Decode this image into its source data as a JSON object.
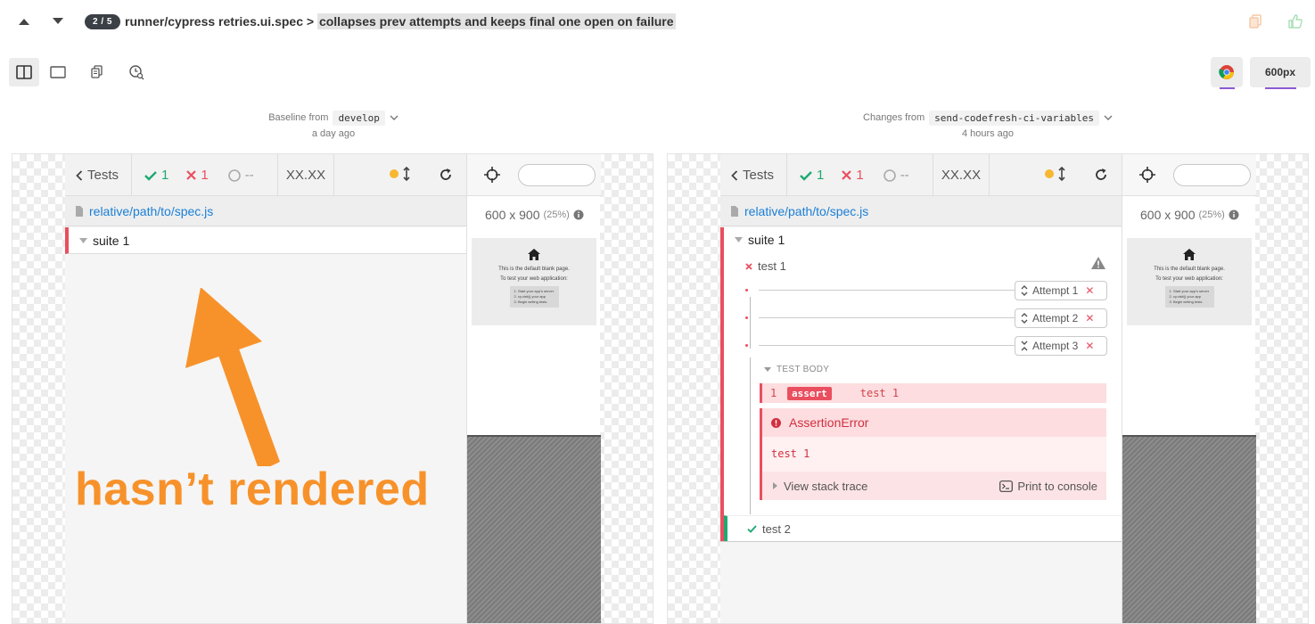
{
  "topbar": {
    "pager": "2 / 5",
    "breadcrumb_prefix": "runner/cypress retries.ui.spec >",
    "breadcrumb_test": "collapses prev attempts and keeps final one open on failure"
  },
  "viewbar": {
    "browser": "chrome",
    "width_label": "600px"
  },
  "baseline": {
    "label": "Baseline from",
    "branch": "develop",
    "ago": "a day ago"
  },
  "changes": {
    "label": "Changes from",
    "branch": "send-codefresh-ci-variables",
    "ago": "4 hours ago"
  },
  "reporter": {
    "tests_label": "Tests",
    "passed": "1",
    "failed": "1",
    "pending": "--",
    "duration": "XX.XX",
    "spec_path": "relative/path/to/spec.js",
    "suite": "suite 1"
  },
  "aut": {
    "size": "600 x 900",
    "scale": "(25%)",
    "blank_line1": "This is the default blank page.",
    "blank_line2": "To test your web application:",
    "steps": [
      "1. Start your app's server",
      "2. cy.visit() your app",
      "3. Begin writing tests"
    ]
  },
  "overlay": {
    "text": "hasn’t rendered"
  },
  "detail": {
    "test1": "test 1",
    "attempts": [
      "Attempt 1",
      "Attempt 2",
      "Attempt 3"
    ],
    "test_body": "TEST BODY",
    "cmd_num": "1",
    "cmd_name": "assert",
    "cmd_msg": "test 1",
    "error_name": "AssertionError",
    "error_msg": "test 1",
    "stack_trace": "View stack trace",
    "print_console": "Print to console",
    "test2": "test 2"
  },
  "colors": {
    "pass": "#1fa971",
    "fail": "#e94f5f",
    "link": "#1b7fd6",
    "overlay": "#f7922b",
    "accent": "#8c5ad4"
  }
}
